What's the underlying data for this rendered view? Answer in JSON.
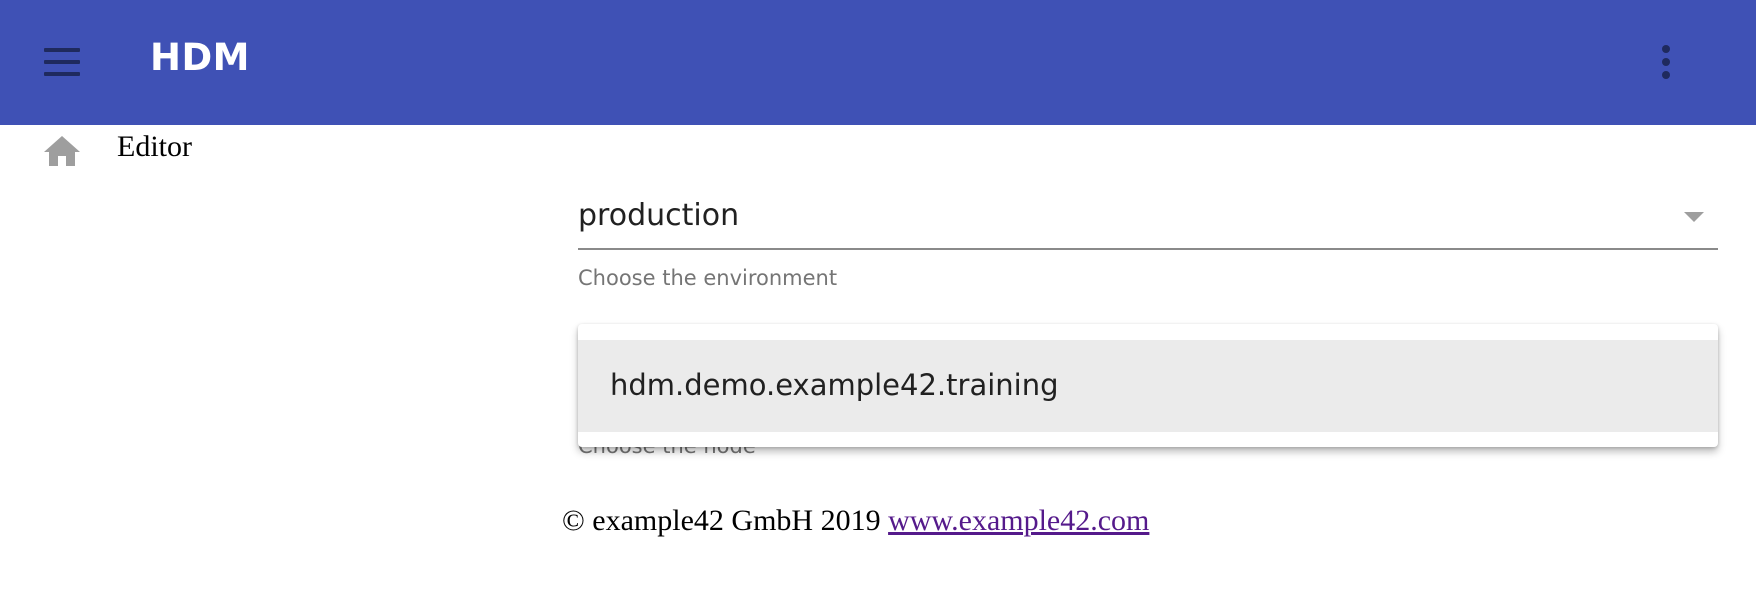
{
  "appbar": {
    "title": "HDM",
    "color": "#3f51b5",
    "menu_icon": "hamburger-menu-icon",
    "more_icon": "more-vert-icon"
  },
  "breadcrumb": {
    "home_icon": "home-icon",
    "label": "Editor"
  },
  "environment_select": {
    "value": "production",
    "hint": "Choose the environment",
    "arrow_icon": "dropdown-arrow-icon"
  },
  "node_select": {
    "hint": "Choose the node",
    "options": [
      {
        "label": "hdm.demo.example42.training",
        "highlighted": true
      }
    ]
  },
  "footer": {
    "copyright": "© example42 GmbH 2019",
    "link_text": "www.example42.com"
  }
}
